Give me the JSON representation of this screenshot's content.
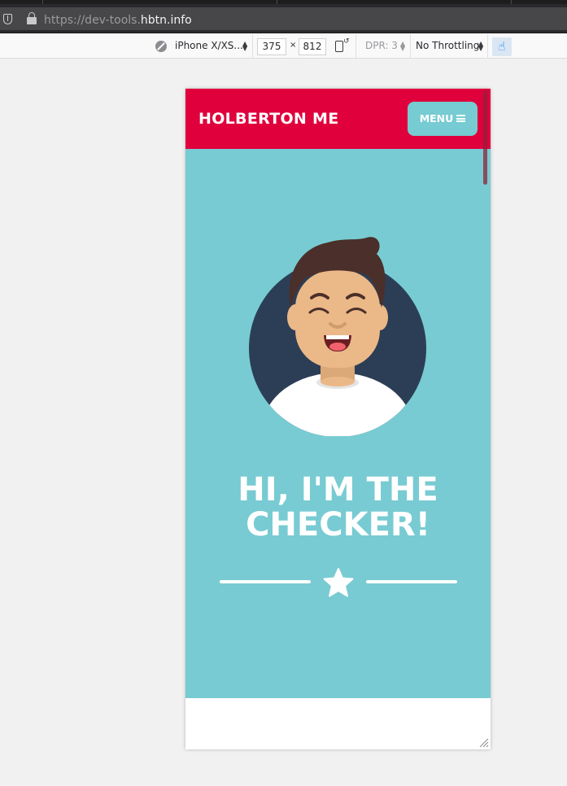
{
  "browser": {
    "url_prefix": "https://dev-tools.",
    "url_host": "hbtn.info",
    "url_suffix": ""
  },
  "rdm": {
    "device": "iPhone X/XS...",
    "width": "375",
    "times": "×",
    "height": "812",
    "dpr": "DPR: 3",
    "throttling": "No Throttling"
  },
  "site": {
    "brand": "HOLBERTON ME",
    "menu_label": "MENU",
    "hero_title_line1": "HI, I'M THE",
    "hero_title_line2": "CHECKER!"
  },
  "colors": {
    "header": "#e0003c",
    "hero": "#78cbd2",
    "menu_button": "#77cbd2",
    "avatar_circle": "#2c3e55"
  }
}
